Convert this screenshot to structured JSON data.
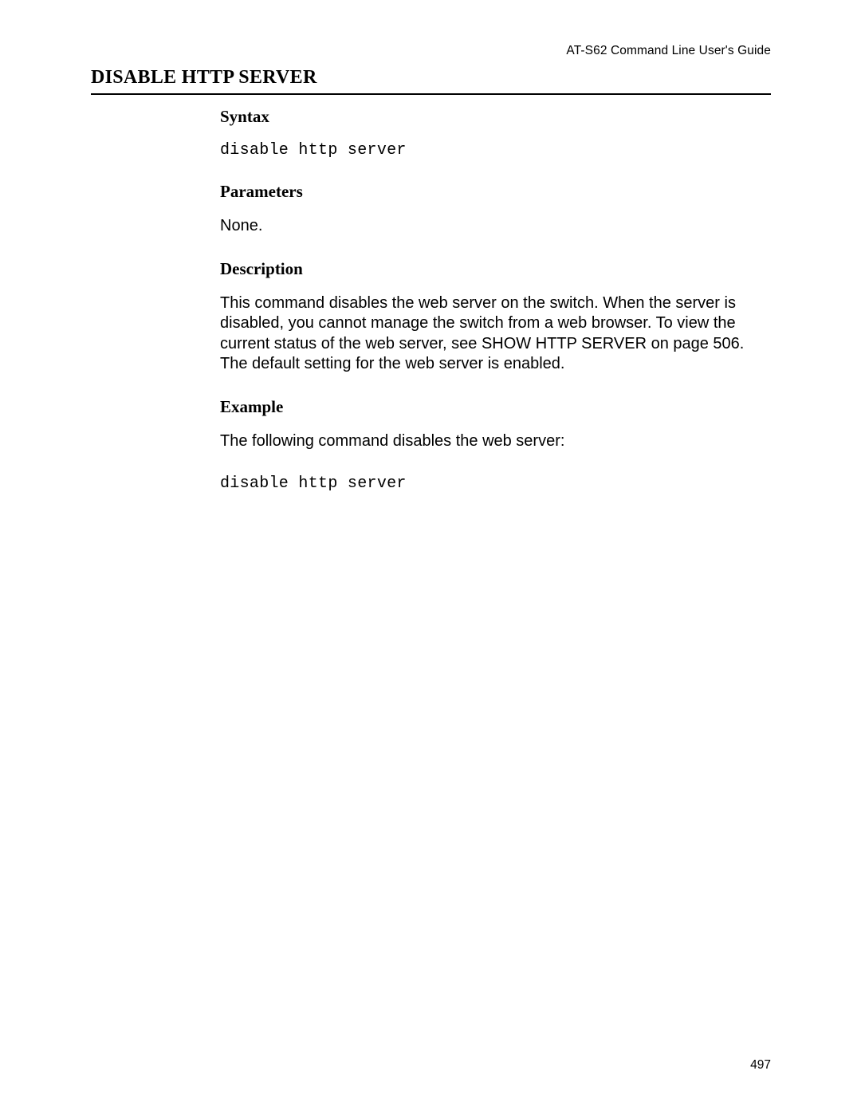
{
  "header": {
    "guide_title": "AT-S62 Command Line User's Guide"
  },
  "page": {
    "number": "497"
  },
  "command": {
    "title": "DISABLE HTTP SERVER",
    "sections": {
      "syntax": {
        "heading": "Syntax",
        "code": "disable http server"
      },
      "parameters": {
        "heading": "Parameters",
        "text": "None."
      },
      "description": {
        "heading": "Description",
        "text": "This command disables the web server on the switch. When the server is disabled, you cannot manage the switch from a web browser. To view the current status of the web server, see SHOW HTTP SERVER on page 506. The default setting for the web server is enabled."
      },
      "example": {
        "heading": "Example",
        "intro": "The following command disables the web server:",
        "code": "disable http server"
      }
    }
  }
}
